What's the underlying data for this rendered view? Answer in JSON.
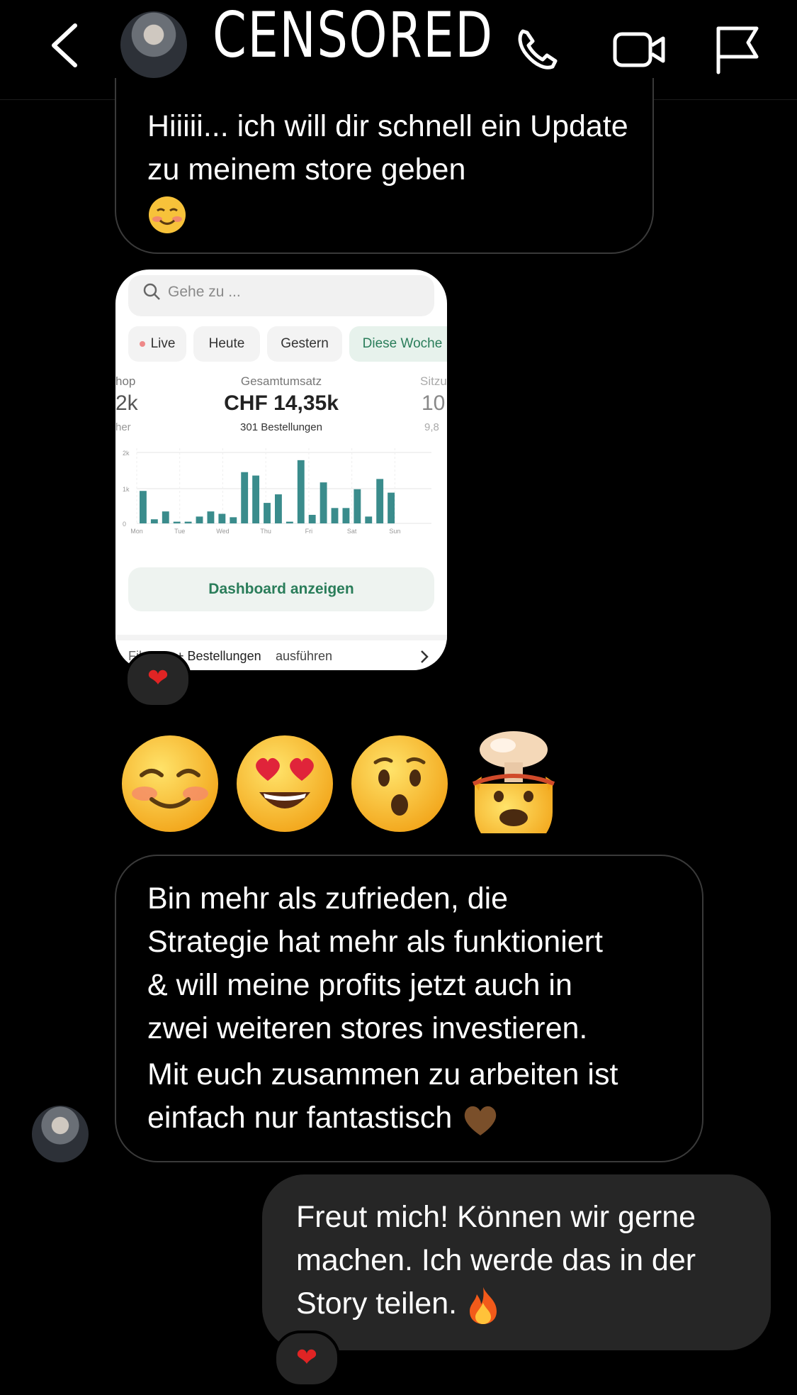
{
  "header": {
    "title": "CENSORED",
    "icons": [
      "back-chevron-icon",
      "phone-icon",
      "video-camera-icon",
      "flag-icon"
    ]
  },
  "messages": {
    "m1": {
      "text": "Hiiiii... ich will dir schnell ein Update zu meinem store geben",
      "emoji": "smiling-blush-emoji"
    },
    "screenshot": {
      "search_placeholder": "Gehe zu ...",
      "tabs": [
        "Live",
        "Heute",
        "Gestern",
        "Diese Woche"
      ],
      "left_label": "hop",
      "left_value": "2k",
      "left_sub": "her",
      "center_label": "Gesamtumsatz",
      "center_value": "CHF 14,35k",
      "center_sub": "301 Bestellungen",
      "right_label": "Sitzu",
      "right_value": "10",
      "right_sub": "9,8",
      "dashboard_button": "Dashboard anzeigen",
      "footer_prefix": "Fil",
      "footer_mid": "+ Bestellungen",
      "footer_suffix": "ausführen",
      "reaction": "heart"
    },
    "emojis": [
      "smiling-blush-emoji",
      "heart-eyes-emoji",
      "hushed-face-emoji",
      "exploding-head-emoji"
    ],
    "m2": {
      "lines": [
        "Bin mehr als zufrieden, die",
        "Strategie hat mehr als funktioniert",
        "& will meine profits jetzt auch in",
        "zwei weiteren stores investieren.",
        "Mit euch zusammen zu arbeiten ist",
        "einfach nur fantastisch"
      ],
      "emoji": "brown-heart-emoji"
    },
    "m3": {
      "lines": [
        "Freut mich! Können wir gerne",
        "machen. Ich werde das in der",
        "Story teilen."
      ],
      "emoji": "fire-emoji",
      "reaction": "heart"
    }
  },
  "chart_data": {
    "type": "bar",
    "x_ticks": [
      "Mon",
      "Tue",
      "Wed",
      "Thu",
      "Fri",
      "Sat",
      "Sun"
    ],
    "y_ticks": [
      "0",
      "1k",
      "2k"
    ],
    "values": [
      0.95,
      0.12,
      0.35,
      0.05,
      0.05,
      0.2,
      0.35,
      0.28,
      0.18,
      1.5,
      1.4,
      0.6,
      0.85,
      0.05,
      1.85,
      0.25,
      1.2,
      0.45,
      0.45,
      1.0,
      0.2,
      1.3,
      0.9
    ],
    "ylim": [
      0,
      2.2
    ],
    "color": "#3a8c8c",
    "grid": true
  },
  "colors": {
    "background": "#000000",
    "incoming_border": "#3a3a3a",
    "outgoing_fill": "#262626",
    "reaction_heart": "#e02424",
    "accent_green": "#2a7d5a"
  }
}
